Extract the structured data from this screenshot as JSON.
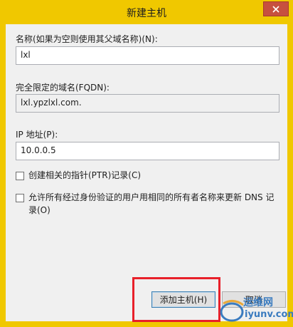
{
  "window": {
    "title": "新建主机"
  },
  "form": {
    "name_label": "名称(如果为空则使用其父域名称)(N):",
    "name_value": "lxl",
    "fqdn_label": "完全限定的域名(FQDN):",
    "fqdn_value": "lxl.ypzlxl.com.",
    "ip_label": "IP 地址(P):",
    "ip_value": "10.0.0.5",
    "ptr_label": "创建相关的指针(PTR)记录(C)",
    "allow_label_line1": "允许所有经过身份验证的用户用相同的所有者名称来更新 DNS 记",
    "allow_label_line2": "录(O)"
  },
  "buttons": {
    "add_host": "添加主机(H)",
    "cancel": "取消"
  },
  "watermark": {
    "cn": "运维网",
    "en": "iyunv.com"
  },
  "colors": {
    "title_bar": "#f0c800",
    "close_button": "#c7503f",
    "highlight_box": "#e8202a",
    "watermark": "#3a7bbf"
  },
  "icons": [
    "close-icon",
    "iyunv-logo-icon"
  ]
}
